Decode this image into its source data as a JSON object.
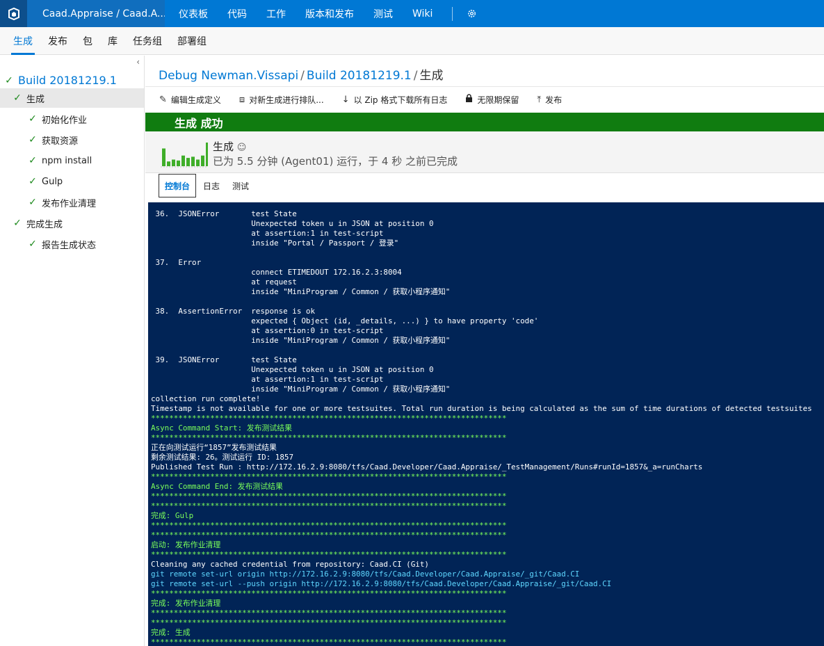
{
  "topbar": {
    "project": "Caad.Appraise / Caad.A...",
    "nav": [
      "仪表板",
      "代码",
      "工作",
      "版本和发布",
      "测试",
      "Wiki"
    ]
  },
  "subnav": {
    "tabs": [
      "生成",
      "发布",
      "包",
      "库",
      "任务组",
      "部署组"
    ]
  },
  "sidebar": {
    "build": "Build 20181219.1",
    "items": [
      {
        "label": "生成"
      },
      {
        "label": "初始化作业"
      },
      {
        "label": "获取资源"
      },
      {
        "label": "npm install"
      },
      {
        "label": "Gulp"
      },
      {
        "label": "发布作业清理"
      },
      {
        "label": "完成生成"
      },
      {
        "label": "报告生成状态"
      }
    ]
  },
  "breadcrumb": {
    "definition": "Debug Newman.Vissapi",
    "build": "Build 20181219.1",
    "current": "生成"
  },
  "toolbar": {
    "edit": "编辑生成定义",
    "queue": "对新生成进行排队...",
    "download": "以 Zip 格式下载所有日志",
    "retain": "无限期保留",
    "release": "发布"
  },
  "status": {
    "banner": "生成 成功",
    "title": "生成",
    "subtitle": "已为 5.5 分钟 (Agent01) 运行，于 4 秒 之前已完成"
  },
  "history_chart": {
    "values": [
      0.75,
      0.2,
      0.28,
      0.24,
      0.45,
      0.35,
      0.4,
      0.28,
      0.45,
      1.0
    ],
    "color": "#3fae29"
  },
  "console_tabs": [
    "控制台",
    "日志",
    "测试"
  ],
  "console": {
    "lines": [
      {
        "t": " 36.  JSONError       test State",
        "c": "w"
      },
      {
        "t": "                      Unexpected token u in JSON at position 0",
        "c": "w"
      },
      {
        "t": "                      at assertion:1 in test-script",
        "c": "w"
      },
      {
        "t": "                      inside \"Portal / Passport / 登录\"",
        "c": "w"
      },
      {
        "t": "",
        "c": "w"
      },
      {
        "t": " 37.  Error",
        "c": "w"
      },
      {
        "t": "                      connect ETIMEDOUT 172.16.2.3:8004",
        "c": "w"
      },
      {
        "t": "                      at request",
        "c": "w"
      },
      {
        "t": "                      inside \"MiniProgram / Common / 获取小程序通知\"",
        "c": "w"
      },
      {
        "t": "",
        "c": "w"
      },
      {
        "t": " 38.  AssertionError  response is ok",
        "c": "w"
      },
      {
        "t": "                      expected { Object (id, _details, ...) } to have property 'code'",
        "c": "w"
      },
      {
        "t": "                      at assertion:0 in test-script",
        "c": "w"
      },
      {
        "t": "                      inside \"MiniProgram / Common / 获取小程序通知\"",
        "c": "w"
      },
      {
        "t": "",
        "c": "w"
      },
      {
        "t": " 39.  JSONError       test State",
        "c": "w"
      },
      {
        "t": "                      Unexpected token u in JSON at position 0",
        "c": "w"
      },
      {
        "t": "                      at assertion:1 in test-script",
        "c": "w"
      },
      {
        "t": "                      inside \"MiniProgram / Common / 获取小程序通知\"",
        "c": "w"
      },
      {
        "t": "collection run complete!",
        "c": "w"
      },
      {
        "t": "Timestamp is not available for one or more testsuites. Total run duration is being calculated as the sum of time durations of detected testsuites",
        "c": "w"
      },
      {
        "t": "******************************************************************************",
        "c": "g"
      },
      {
        "t": "Async Command Start: 发布测试结果",
        "c": "g"
      },
      {
        "t": "******************************************************************************",
        "c": "g"
      },
      {
        "t": "正在向测试运行“1857”发布测试结果",
        "c": "w"
      },
      {
        "t": "剩余测试结果: 26。测试运行 ID: 1857",
        "c": "w"
      },
      {
        "t": "Published Test Run : http://172.16.2.9:8080/tfs/Caad.Developer/Caad.Appraise/_TestManagement/Runs#runId=1857&_a=runCharts",
        "c": "w"
      },
      {
        "t": "******************************************************************************",
        "c": "g"
      },
      {
        "t": "Async Command End: 发布测试结果",
        "c": "g"
      },
      {
        "t": "******************************************************************************",
        "c": "g"
      },
      {
        "t": "******************************************************************************",
        "c": "g"
      },
      {
        "t": "完成: Gulp",
        "c": "g"
      },
      {
        "t": "******************************************************************************",
        "c": "g"
      },
      {
        "t": "******************************************************************************",
        "c": "g"
      },
      {
        "t": "启动: 发布作业清理",
        "c": "g"
      },
      {
        "t": "******************************************************************************",
        "c": "g"
      },
      {
        "t": "Cleaning any cached credential from repository: Caad.CI (Git)",
        "c": "w"
      },
      {
        "t": "git remote set-url origin http://172.16.2.9:8080/tfs/Caad.Developer/Caad.Appraise/_git/Caad.CI",
        "c": "c"
      },
      {
        "t": "git remote set-url --push origin http://172.16.2.9:8080/tfs/Caad.Developer/Caad.Appraise/_git/Caad.CI",
        "c": "c"
      },
      {
        "t": "******************************************************************************",
        "c": "g"
      },
      {
        "t": "完成: 发布作业清理",
        "c": "g"
      },
      {
        "t": "******************************************************************************",
        "c": "g"
      },
      {
        "t": "******************************************************************************",
        "c": "g"
      },
      {
        "t": "完成: 生成",
        "c": "g"
      },
      {
        "t": "******************************************************************************",
        "c": "g"
      }
    ]
  }
}
